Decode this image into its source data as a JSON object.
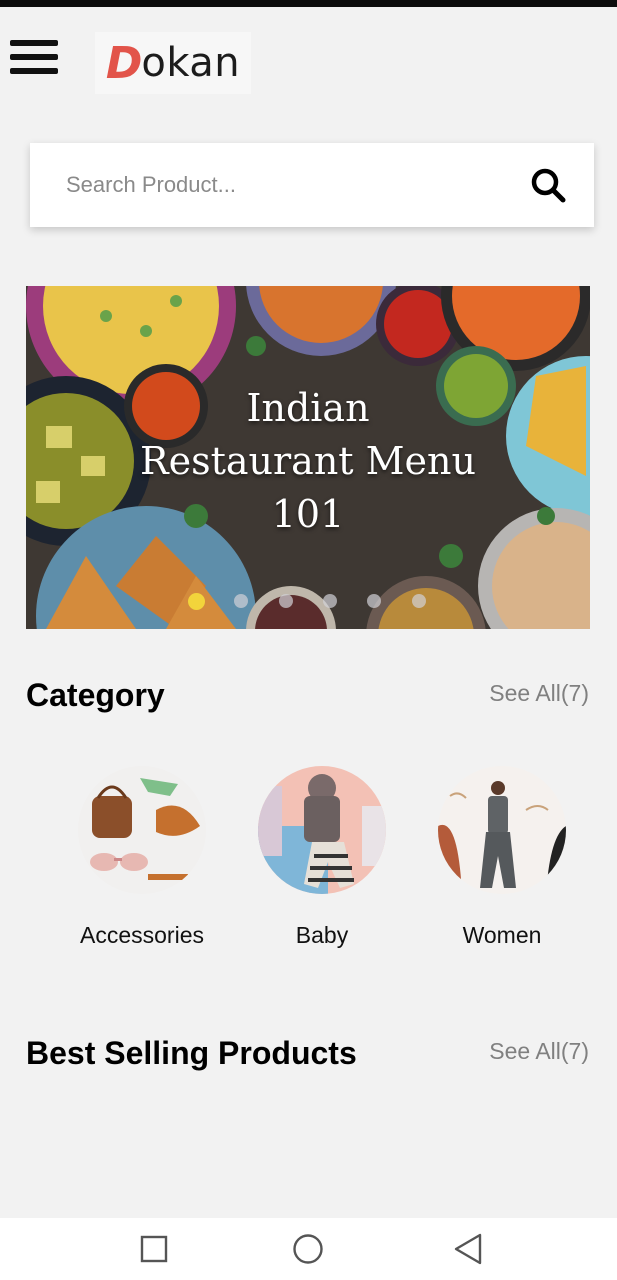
{
  "header": {
    "logo_initial": "D",
    "logo_rest": "okan"
  },
  "search": {
    "placeholder": "Search Product..."
  },
  "banner": {
    "title": "Indian\nRestaurant Menu\n101",
    "slides_total": 6,
    "active_slide": 1
  },
  "category_section": {
    "title": "Category",
    "see_all": "See All(7)",
    "items": [
      {
        "label": "Accessories",
        "icon": "accessories-image"
      },
      {
        "label": "Baby",
        "icon": "baby-clothes-image"
      },
      {
        "label": "Women",
        "icon": "women-fashion-image"
      }
    ]
  },
  "best_selling_section": {
    "title": "Best Selling Products",
    "see_all": "See All(7)"
  },
  "colors": {
    "brand_red": "#e2544a",
    "dot_active": "#f2d43b",
    "background": "#f2f2f2"
  },
  "navigation": {
    "recent_icon": "square-icon",
    "home_icon": "circle-icon",
    "back_icon": "triangle-back-icon"
  }
}
